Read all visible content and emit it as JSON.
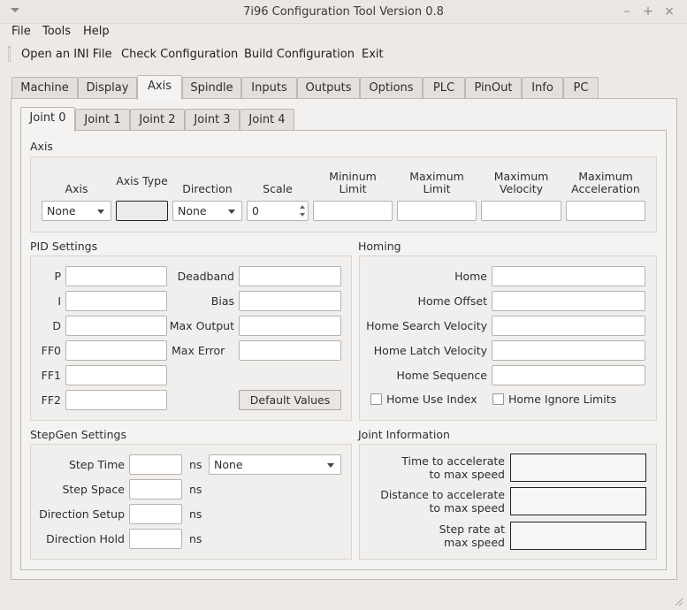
{
  "window": {
    "title": "7i96 Configuration Tool Version 0.8"
  },
  "menu": [
    "File",
    "Tools",
    "Help"
  ],
  "toolbar": [
    "Open an INI File",
    "Check Configuration",
    "Build Configuration",
    "Exit"
  ],
  "tabs": [
    "Machine",
    "Display",
    "Axis",
    "Spindle",
    "Inputs",
    "Outputs",
    "Options",
    "PLC",
    "PinOut",
    "Info",
    "PC"
  ],
  "active_tab": "Axis",
  "joint_tabs": [
    "Joint 0",
    "Joint 1",
    "Joint 2",
    "Joint 3",
    "Joint 4"
  ],
  "active_joint": "Joint 0",
  "axis": {
    "title": "Axis",
    "labels": {
      "axis": "Axis",
      "axis_type": "Axis Type",
      "direction": "Direction",
      "scale": "Scale",
      "min_limit": "Mininum\nLimit",
      "max_limit": "Maximum\nLimit",
      "max_velocity": "Maximum\nVelocity",
      "max_accel": "Maximum\nAcceleration"
    },
    "axis_value": "None",
    "direction_value": "None",
    "scale_value": "0"
  },
  "pid": {
    "title": "PID Settings",
    "left": [
      "P",
      "I",
      "D",
      "FF0",
      "FF1",
      "FF2"
    ],
    "right": [
      "Deadband",
      "Bias",
      "Max Output",
      "Max Error"
    ],
    "default_button": "Default Values"
  },
  "homing": {
    "title": "Homing",
    "fields": [
      "Home",
      "Home Offset",
      "Home Search Velocity",
      "Home Latch Velocity",
      "Home Sequence"
    ],
    "checks": [
      "Home Use Index",
      "Home Ignore Limits"
    ]
  },
  "stepgen": {
    "title": "StepGen Settings",
    "fields": [
      "Step Time",
      "Step Space",
      "Direction Setup",
      "Direction Hold"
    ],
    "unit": "ns",
    "driver_value": "None"
  },
  "joint_info": {
    "title": "Joint Information",
    "fields": [
      "Time to accelerate\nto max speed",
      "Distance to accelerate\nto max speed",
      "Step rate at\nmax speed"
    ]
  }
}
